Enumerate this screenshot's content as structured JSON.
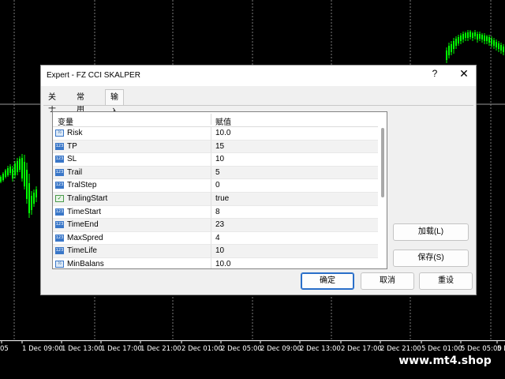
{
  "chart": {
    "background": "#000000",
    "candle_color": "#00ff00",
    "time_axis_labels": [
      "05",
      "1 Dec 09:00",
      "1 Dec 13:00",
      "1 Dec 17:00",
      "1 Dec 21:00",
      "2 Dec 01:00",
      "2 Dec 05:00",
      "2 Dec 09:00",
      "2 Dec 13:00",
      "2 Dec 17:00",
      "2 Dec 21:00",
      "5 Dec 01:00",
      "5 Dec 05:00",
      "5 Dec"
    ]
  },
  "watermark": "www.mt4.shop",
  "dialog": {
    "title": "Expert - FZ CCI SKALPER",
    "help": "?",
    "close": "✕",
    "tabs": [
      "关于",
      "常用",
      "输入参数"
    ],
    "active_tab": "输入参数",
    "grid": {
      "col_variable": "变量",
      "col_value": "赋值",
      "rows": [
        {
          "icon": "dbl",
          "icon_text": "½",
          "name": "Risk",
          "value": "10.0"
        },
        {
          "icon": "int",
          "icon_text": "123",
          "name": "TP",
          "value": "15"
        },
        {
          "icon": "int",
          "icon_text": "123",
          "name": "SL",
          "value": "10"
        },
        {
          "icon": "int",
          "icon_text": "123",
          "name": "Trail",
          "value": "5"
        },
        {
          "icon": "int",
          "icon_text": "123",
          "name": "TralStep",
          "value": "0"
        },
        {
          "icon": "bool",
          "icon_text": "✓",
          "name": "TralingStart",
          "value": "true"
        },
        {
          "icon": "int",
          "icon_text": "123",
          "name": "TimeStart",
          "value": "8"
        },
        {
          "icon": "int",
          "icon_text": "123",
          "name": "TimeEnd",
          "value": "23"
        },
        {
          "icon": "int",
          "icon_text": "123",
          "name": "MaxSpred",
          "value": "4"
        },
        {
          "icon": "int",
          "icon_text": "123",
          "name": "TimeLife",
          "value": "10"
        },
        {
          "icon": "dbl",
          "icon_text": "½",
          "name": "MinBalans",
          "value": "10.0"
        }
      ]
    },
    "buttons": {
      "load": "加载(L)",
      "save": "保存(S)",
      "ok": "确定",
      "cancel": "取消",
      "reset": "重设"
    }
  }
}
